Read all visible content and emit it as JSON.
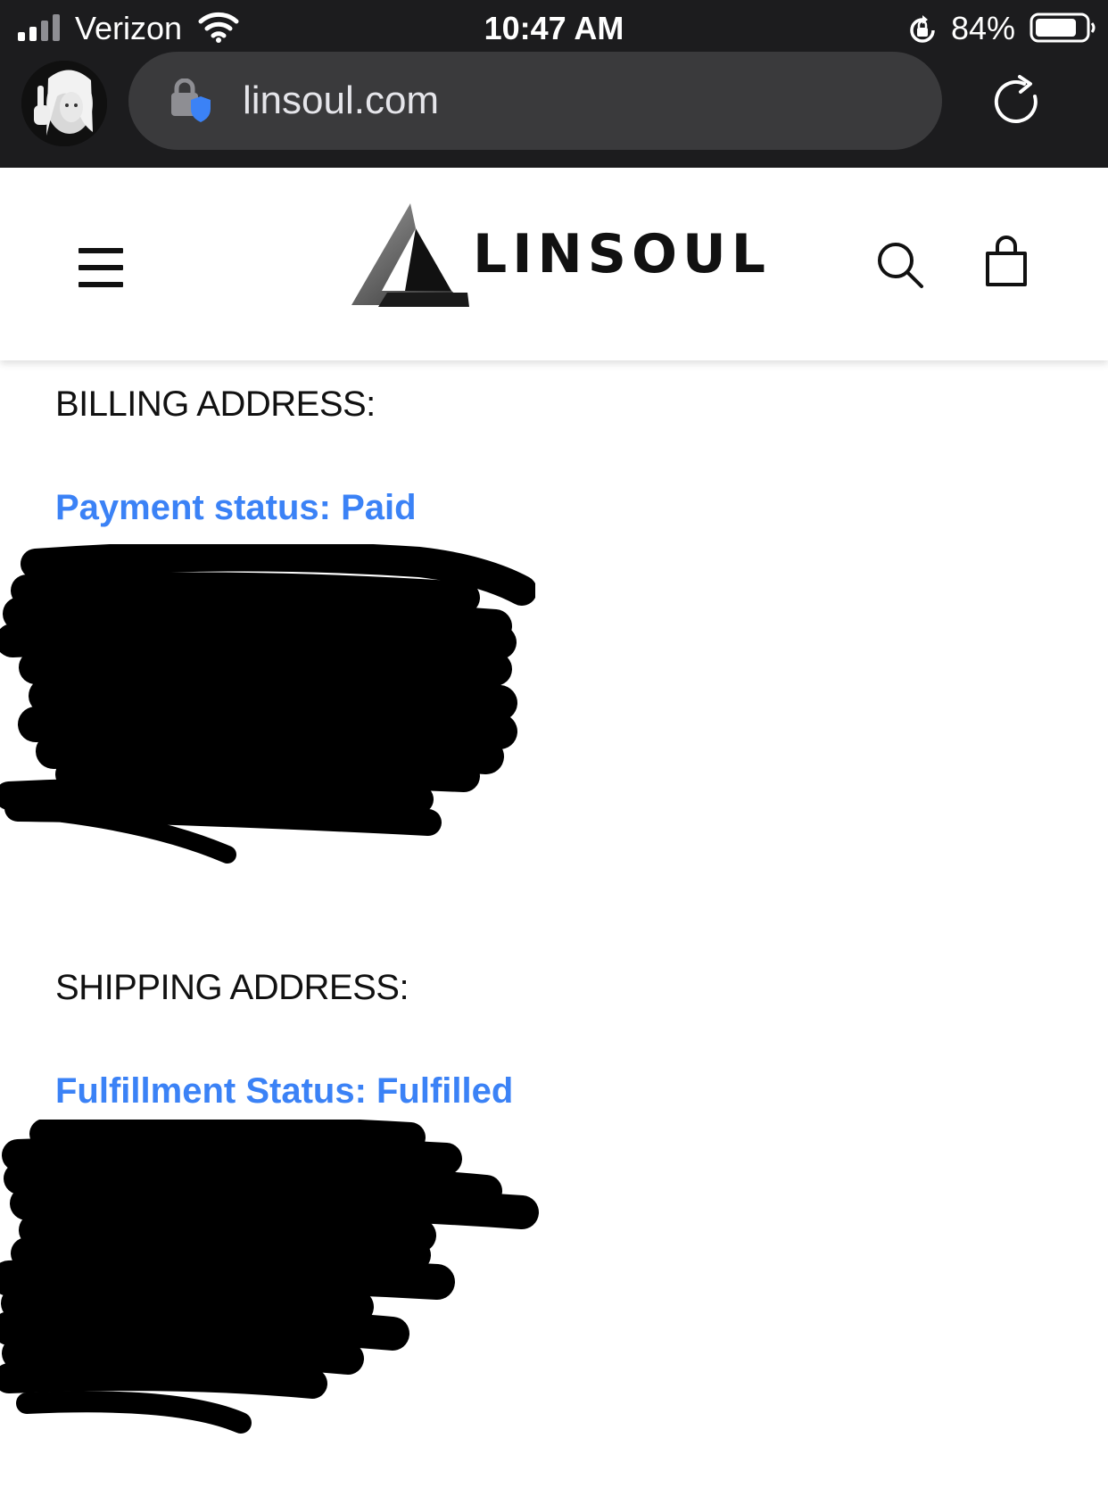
{
  "status_bar": {
    "carrier": "Verizon",
    "time": "10:47 AM",
    "battery_percent": "84%",
    "signal_bars": 2,
    "battery_level": 0.84
  },
  "browser": {
    "url": "linsoul.com"
  },
  "header": {
    "logo_text": "LINSOUL",
    "icons": [
      "menu-icon",
      "search-icon",
      "shopping-bag-icon"
    ]
  },
  "billing": {
    "heading": "BILLING ADDRESS:",
    "status": "Payment status: Paid"
  },
  "shipping": {
    "heading": "SHIPPING ADDRESS:",
    "status": "Fulfillment Status: Fulfilled"
  },
  "colors": {
    "status_text": "#3b82f6",
    "chrome_bg": "#1c1c1e",
    "url_bar_bg": "#3a3a3c",
    "redaction": "#000000"
  }
}
